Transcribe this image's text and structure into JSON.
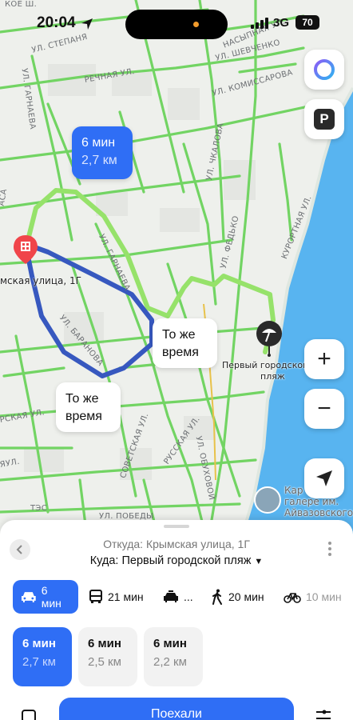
{
  "status_bar": {
    "time": "20:04",
    "network": "3G",
    "battery": "70"
  },
  "map": {
    "streets": [
      "КОЕ Ш.",
      "УЛ. СТЕПАНЯ",
      "УЛ. ГАРНАЕВА",
      "РЕЧНАЯ УЛ.",
      "НАСЫПНАЯ УЛ.",
      "УЛ. ШЕВЧЕНКО",
      "УЛ. КОМИССАРОВА",
      "УЛ. ЧКАЛОВА",
      "АСА",
      "УЛ. ГАРНАЕВА",
      "УЛ. ФЕДЬКО",
      "КУРОРТНАЯ УЛ.",
      "УЛ. БАРАНОВА",
      "РСКАЯ УЛ.",
      "ЯУЛ.",
      "СОВЕТСКАЯ УЛ.",
      "РУССКАЯ УЛ.",
      "УЛ. ОБУХОВОЙ",
      "ТЭС",
      "УЛ. ПОБЕДЫ"
    ],
    "selected_route_bubble": {
      "time": "6 мин",
      "distance": "2,7 км"
    },
    "alt_bubble_1": {
      "line1": "То же",
      "line2": "время"
    },
    "alt_bubble_2": {
      "line1": "То же",
      "line2": "время"
    },
    "origin_label": "мская улица, 1Г",
    "destination_label_1": "Первый городской",
    "destination_label_2": "пляж",
    "poi_label_1": "Кар",
    "poi_label_2": "галере им.",
    "poi_label_3": "Айвазовского",
    "controls": {
      "zoom_in": "+",
      "zoom_out": "−",
      "parking": "P"
    },
    "colors": {
      "route_selected": "#2f6ef5",
      "route_alt": "#3a5bb8",
      "traffic_green": "#6cd35a",
      "water": "#58b4f0"
    }
  },
  "sheet": {
    "from": "Откуда: Крымская улица, 1Г",
    "to": "Куда: Первый городской пляж",
    "to_arrow": "▼",
    "modes": [
      {
        "icon": "car-icon",
        "label": "6 мин"
      },
      {
        "icon": "bus-icon",
        "label": "21 мин"
      },
      {
        "icon": "taxi-icon",
        "label": "..."
      },
      {
        "icon": "walk-icon",
        "label": "20 мин"
      },
      {
        "icon": "bike-icon",
        "label": "10 мин"
      }
    ],
    "variants": [
      {
        "time": "6 мин",
        "distance": "2,7 км"
      },
      {
        "time": "6 мин",
        "distance": "2,5 км"
      },
      {
        "time": "6 мин",
        "distance": "2,2 км"
      }
    ],
    "go_button": "Поехали"
  }
}
